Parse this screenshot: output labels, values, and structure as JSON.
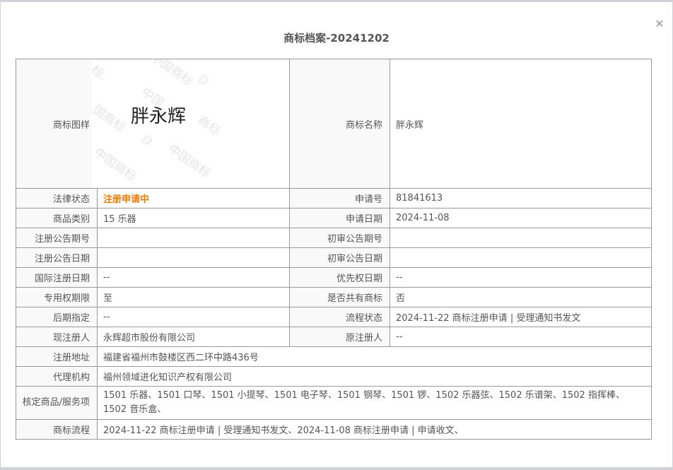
{
  "dialog": {
    "title": "商标档案-20241202",
    "close_icon": "close-icon"
  },
  "trademark_image": {
    "mark_text": "胖永辉",
    "watermark": "中国商标"
  },
  "rows": [
    {
      "label": "商标图样",
      "label2": "商标名称",
      "value2": "胖永辉"
    },
    {
      "label": "法律状态",
      "value": "注册申请中",
      "label2": "申请号",
      "value2": "81841613"
    },
    {
      "label": "商品类别",
      "value": "15 乐器",
      "label2": "申请日期",
      "value2": "2024-11-08"
    },
    {
      "label": "注册公告期号",
      "value": "",
      "label2": "初审公告期号",
      "value2": ""
    },
    {
      "label": "注册公告日期",
      "value": "",
      "label2": "初审公告日期",
      "value2": ""
    },
    {
      "label": "国际注册日期",
      "value": "--",
      "label2": "优先权日期",
      "value2": "--"
    },
    {
      "label": "专用权期限",
      "value": "至",
      "label2": "是否共有商标",
      "value2": "否"
    },
    {
      "label": "后期指定",
      "value": "--",
      "label2": "流程状态",
      "value2": "2024-11-22 商标注册申请 | 受理通知书发文"
    },
    {
      "label": "现注册人",
      "value": "永辉超市股份有限公司",
      "label2": "原注册人",
      "value2": "--"
    },
    {
      "label": "注册地址",
      "value": "福建省福州市鼓楼区西二环中路436号"
    },
    {
      "label": "代理机构",
      "value": "福州领域进化知识产权有限公司"
    },
    {
      "label": "核定商品/服务项",
      "value": "1501 乐器、1501 口琴、1501 小提琴、1501 电子琴、1501 钢琴、1501 锣、1502 乐器弦、1502 乐谱架、1502 指挥棒、1502 音乐盒、"
    },
    {
      "label": "商标流程",
      "value": "2024-11-22 商标注册申请 | 受理通知书发文、2024-11-08 商标注册申请 | 申请收文、"
    }
  ],
  "colors": {
    "status": "#f07800",
    "border": "#999999",
    "label_bg": "#f9f9f9"
  }
}
